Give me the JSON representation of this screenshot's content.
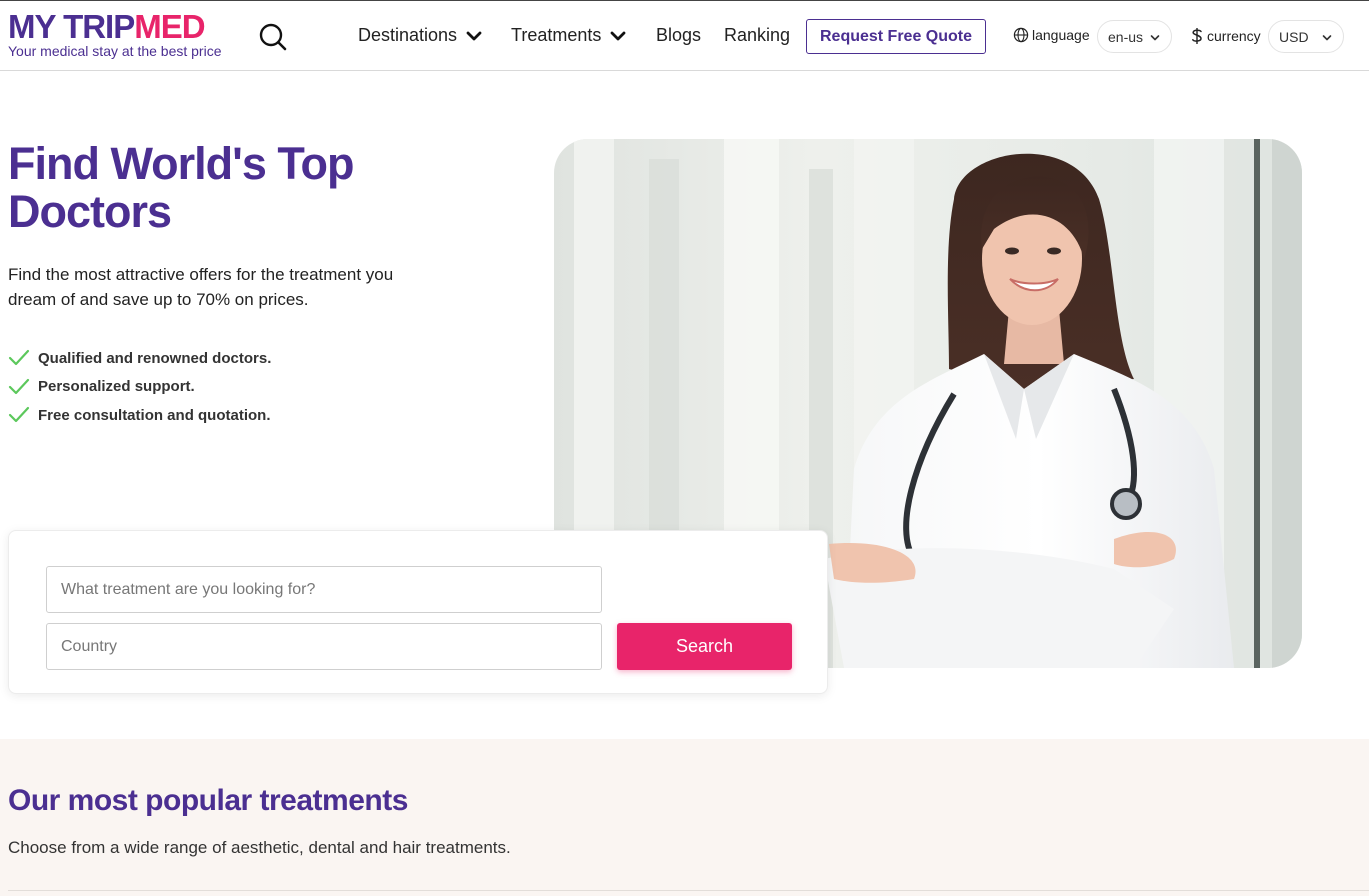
{
  "header": {
    "logo_trip": "MY TRIP",
    "logo_med": "MED",
    "logo_tagline": "Your medical stay at the best price",
    "nav": [
      {
        "label": "Destinations",
        "has_dropdown": true
      },
      {
        "label": "Treatments",
        "has_dropdown": true
      },
      {
        "label": "Blogs",
        "has_dropdown": false
      },
      {
        "label": "Ranking",
        "has_dropdown": false
      }
    ],
    "quote_button": "Request Free Quote",
    "language_label": "language",
    "language_value": "en-us",
    "currency_label": "currency",
    "currency_value": "USD",
    "icons": [
      "search-icon",
      "chevron-down-icon",
      "globe-icon",
      "dollar-icon"
    ]
  },
  "hero": {
    "title": "Find World's Top Doctors",
    "subtitle": "Find the most attractive offers for the treatment you dream of and save up to 70% on prices.",
    "features": [
      "Qualified and renowned doctors.",
      "Personalized support.",
      "Free consultation and quotation."
    ],
    "feature_icon": "checkmark-icon"
  },
  "search": {
    "treatment_placeholder": "What treatment are you looking for?",
    "country_placeholder": "Country",
    "button_label": "Search"
  },
  "popular": {
    "title": "Our most popular treatments",
    "subtitle": "Choose from a wide range of aesthetic, dental and hair treatments."
  },
  "colors": {
    "brand_purple": "#4b2f91",
    "brand_pink": "#e8246a",
    "check_green": "#5cc85c",
    "section_bg": "#faf5f2"
  }
}
